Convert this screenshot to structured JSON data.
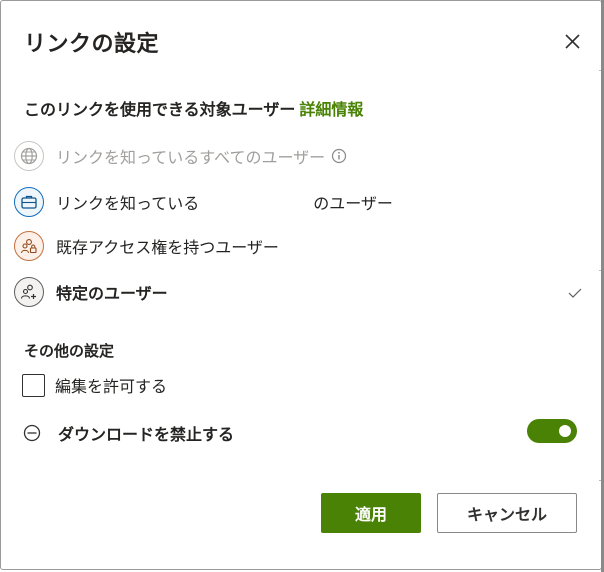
{
  "dialog": {
    "title": "リンクの設定",
    "close_label": "閉じる"
  },
  "audience": {
    "heading": "このリンクを使用できる対象ユーザー",
    "more_info": "詳細情報",
    "options": [
      {
        "label": "リンクを知っているすべてのユーザー",
        "icon": "globe-icon",
        "disabled": true,
        "has_info": true
      },
      {
        "label_prefix": "リンクを知っている",
        "label_suffix": "のユーザー",
        "icon": "briefcase-icon",
        "disabled": false
      },
      {
        "label": "既存アクセス権を持つユーザー",
        "icon": "people-lock-icon",
        "disabled": false
      },
      {
        "label": "特定のユーザー",
        "icon": "people-add-icon",
        "disabled": false,
        "selected": true
      }
    ]
  },
  "other_settings": {
    "heading": "その他の設定",
    "allow_edit": {
      "label": "編集を許可する",
      "checked": false
    },
    "block_download": {
      "label": "ダウンロードを禁止する",
      "enabled": true
    }
  },
  "buttons": {
    "apply": "適用",
    "cancel": "キャンセル"
  },
  "colors": {
    "accent": "#498205",
    "text": "#252423",
    "disabled_text": "#a19f9d"
  }
}
